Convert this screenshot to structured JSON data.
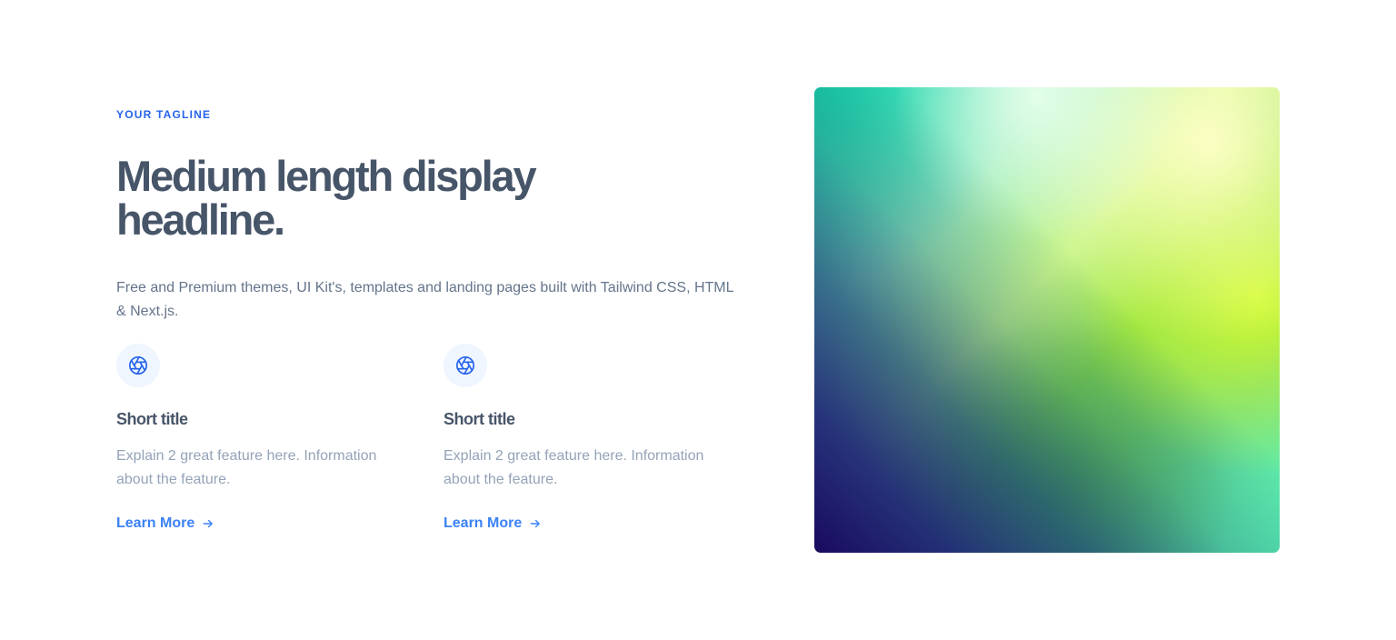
{
  "hero": {
    "tagline": "YOUR TAGLINE",
    "headline": "Medium length display headline.",
    "lead": "Free and Premium themes, UI Kit's, templates and landing pages built with Tailwind CSS, HTML & Next.js."
  },
  "features": [
    {
      "icon": "aperture-icon",
      "title": "Short title",
      "description": "Explain 2 great feature here. Information about the feature.",
      "link_label": "Learn More"
    },
    {
      "icon": "aperture-icon",
      "title": "Short title",
      "description": "Explain 2 great feature here. Information about the feature.",
      "link_label": "Learn More"
    }
  ],
  "colors": {
    "accent": "#2563eb",
    "link": "#3b82f6",
    "heading": "#475569",
    "body": "#64748b",
    "muted": "#94a3b8",
    "icon_bg": "#eff6ff"
  }
}
